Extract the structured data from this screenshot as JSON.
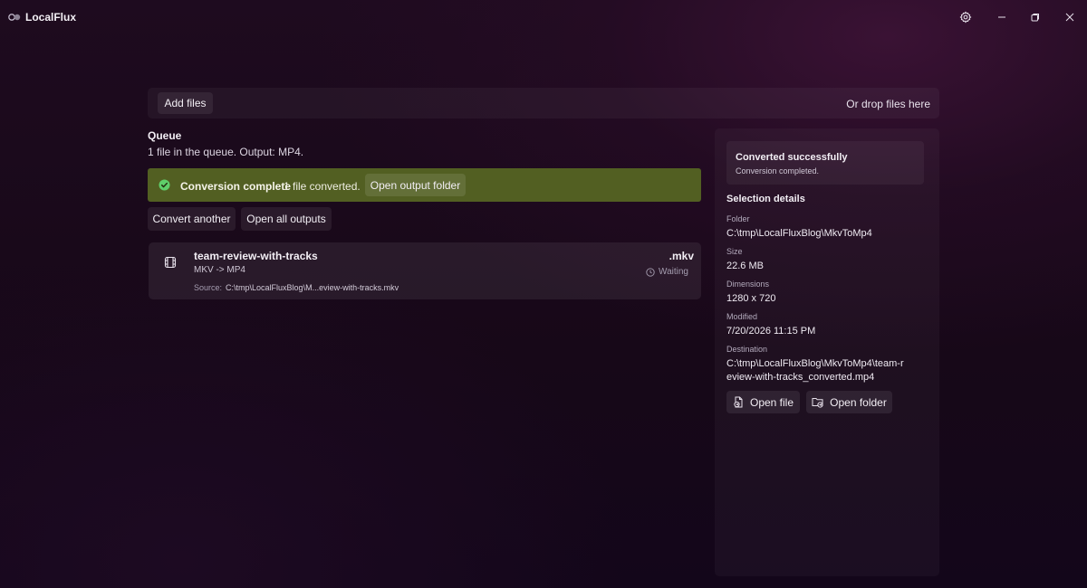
{
  "app": {
    "title": "LocalFlux"
  },
  "toolbar": {
    "add_files_label": "Add files",
    "drop_hint": "Or drop files here"
  },
  "queue": {
    "title": "Queue",
    "summary": "1 file in the queue. Output: MP4."
  },
  "banner": {
    "title": "Conversion complete",
    "message": "1 file converted.",
    "open_output_label": "Open output folder",
    "color": "#525f22"
  },
  "actions": {
    "convert_another_label": "Convert another",
    "open_all_label": "Open all outputs"
  },
  "items": [
    {
      "name": "team-review-with-tracks",
      "extension": ".mkv",
      "conversion": "MKV -> MP4",
      "status": "Waiting",
      "source_label": "Source:",
      "source_path": "C:\\tmp\\LocalFluxBlog\\M...eview-with-tracks.mkv",
      "icon": "film-icon"
    }
  ],
  "details": {
    "status_title": "Converted successfully",
    "status_subtitle": "Conversion completed.",
    "section_title": "Selection details",
    "folder_label": "Folder",
    "folder_value": "C:\\tmp\\LocalFluxBlog\\MkvToMp4",
    "size_label": "Size",
    "size_value": "22.6 MB",
    "dimensions_label": "Dimensions",
    "dimensions_value": "1280 x 720",
    "modified_label": "Modified",
    "modified_value": "7/20/2026 11:15 PM",
    "destination_label": "Destination",
    "destination_value": "C:\\tmp\\LocalFluxBlog\\MkvToMp4\\team-review-with-tracks_converted.mp4",
    "open_file_label": "Open file",
    "open_folder_label": "Open folder"
  },
  "icons": {
    "settings": "gear-icon",
    "minimize": "minimize-icon",
    "maximize": "restore-icon",
    "close": "close-icon",
    "success": "check-circle-icon",
    "clock": "clock-icon"
  }
}
